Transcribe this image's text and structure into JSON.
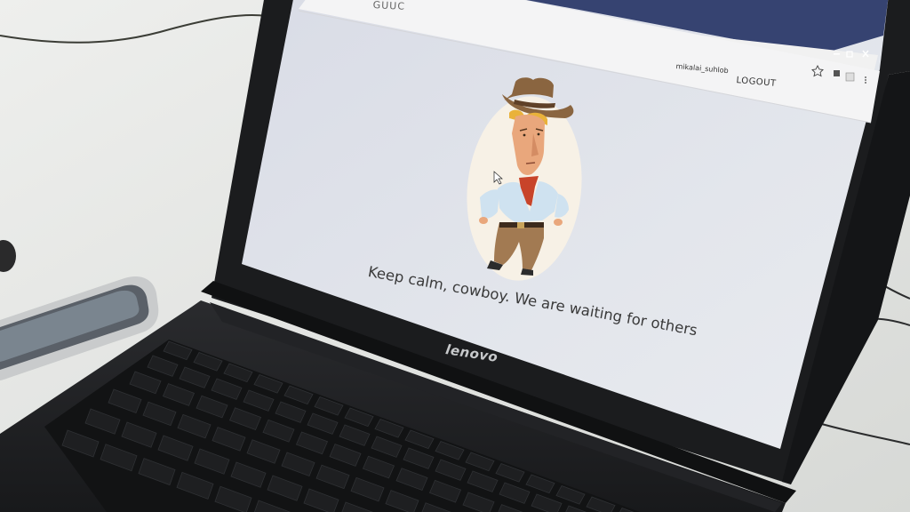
{
  "app": {
    "brand": "GUUC"
  },
  "header": {
    "username": "mikalai_suhlob",
    "logout_label": "LOGOUT"
  },
  "main": {
    "waiting_message": "Keep calm, cowboy. We are waiting for others"
  },
  "laptop": {
    "logo": "lenovo"
  },
  "browser": {
    "icons": [
      "minimize-icon",
      "maximize-icon",
      "close-icon",
      "bookmark-star-icon",
      "extension-icon",
      "menu-icon"
    ]
  },
  "colors": {
    "screen_bg": "#dde0e8",
    "bezel": "#1b1c1e",
    "desk": "#e4e6e3",
    "hat": "#8a6540",
    "scarf": "#c8442a"
  }
}
